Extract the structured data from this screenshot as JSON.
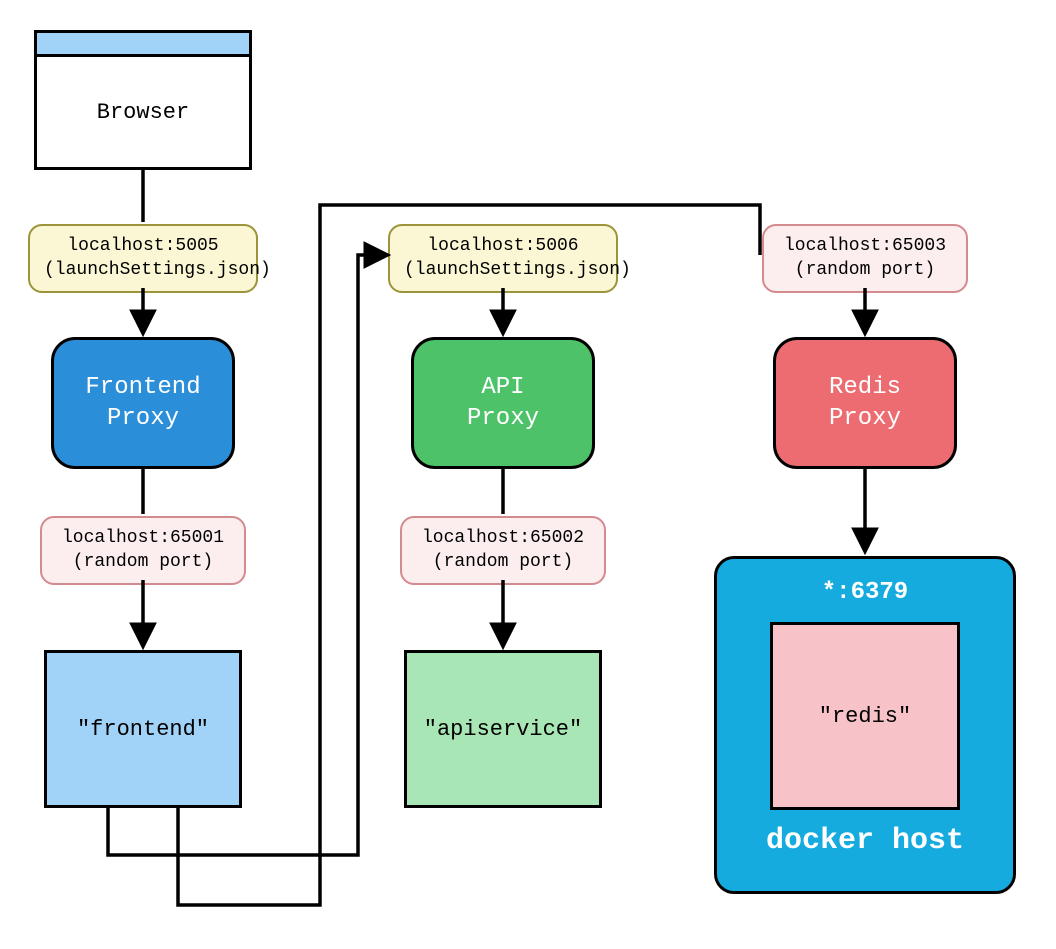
{
  "browser": {
    "label": "Browser"
  },
  "labels": {
    "frontend_port": "localhost:5005\n(launchSettings.json)",
    "api_port": "localhost:5006\n(launchSettings.json)",
    "redis_port": "localhost:65003\n(random port)",
    "frontend_internal": "localhost:65001\n(random port)",
    "api_internal": "localhost:65002\n(random port)"
  },
  "proxies": {
    "frontend": "Frontend\nProxy",
    "api": "API\nProxy",
    "redis": "Redis\nProxy"
  },
  "services": {
    "frontend": "\"frontend\"",
    "api": "\"apiservice\"",
    "redis": "\"redis\""
  },
  "docker": {
    "port": "*:6379",
    "label": "docker host"
  }
}
